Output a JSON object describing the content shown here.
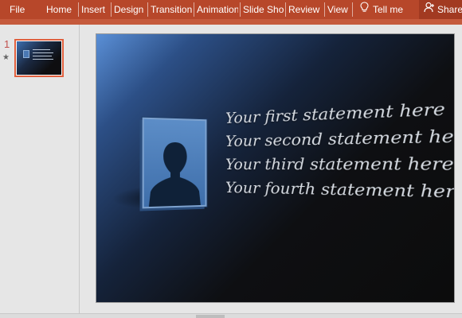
{
  "ribbon": {
    "tabs": [
      "File",
      "Home",
      "Insert",
      "Design",
      "Transitions",
      "Animations",
      "Slide Show",
      "Review",
      "View"
    ],
    "tell_me": "Tell me",
    "share": "Share"
  },
  "thumbnails": [
    {
      "number": "1",
      "marker": "★"
    }
  ],
  "slide": {
    "statements": [
      "Your first statement here",
      "Your second statement here",
      "Your third statement here",
      "Your fourth statement here"
    ]
  },
  "colors": {
    "ribbon": "#b7472a",
    "thumb_selected": "#e0603e"
  }
}
